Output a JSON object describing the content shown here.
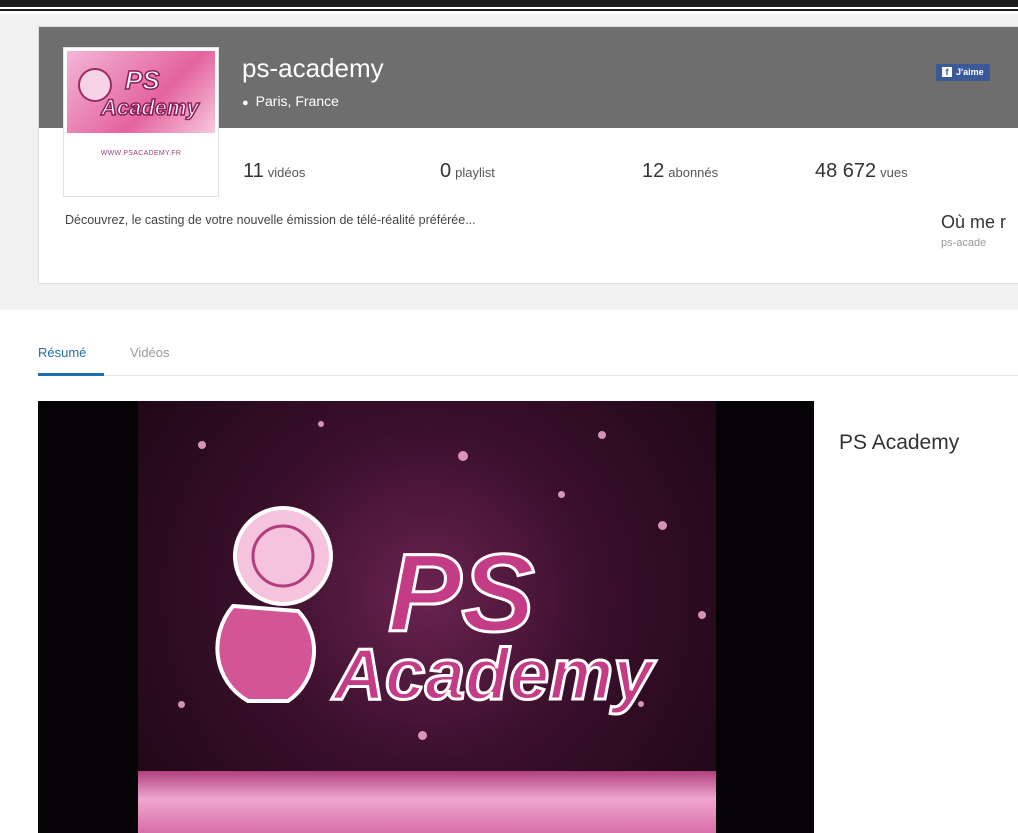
{
  "channel": {
    "name": "ps-academy",
    "location": "Paris, France",
    "avatar_url_text": "WWW.PSACADEMY.FR",
    "like_button": "J'aime"
  },
  "stats": [
    {
      "value": "11",
      "label": "vidéos"
    },
    {
      "value": "0",
      "label": "playlist"
    },
    {
      "value": "12",
      "label": "abonnés"
    },
    {
      "value": "48 672",
      "label": "vues"
    }
  ],
  "description": "Découvrez, le casting de votre nouvelle émission de télé-réalité préférée...",
  "links": {
    "title": "Où me r",
    "subtitle": "ps-acade"
  },
  "tabs": [
    {
      "label": "Résumé",
      "active": true
    },
    {
      "label": "Vidéos",
      "active": false
    }
  ],
  "featured": {
    "title": "PS Academy",
    "logo_text_top": "PS",
    "logo_text_bottom": "Academy"
  },
  "colors": {
    "accent": "#1f6fa8",
    "banner": "#6e6e6e",
    "brand_pink": "#e4639e"
  }
}
